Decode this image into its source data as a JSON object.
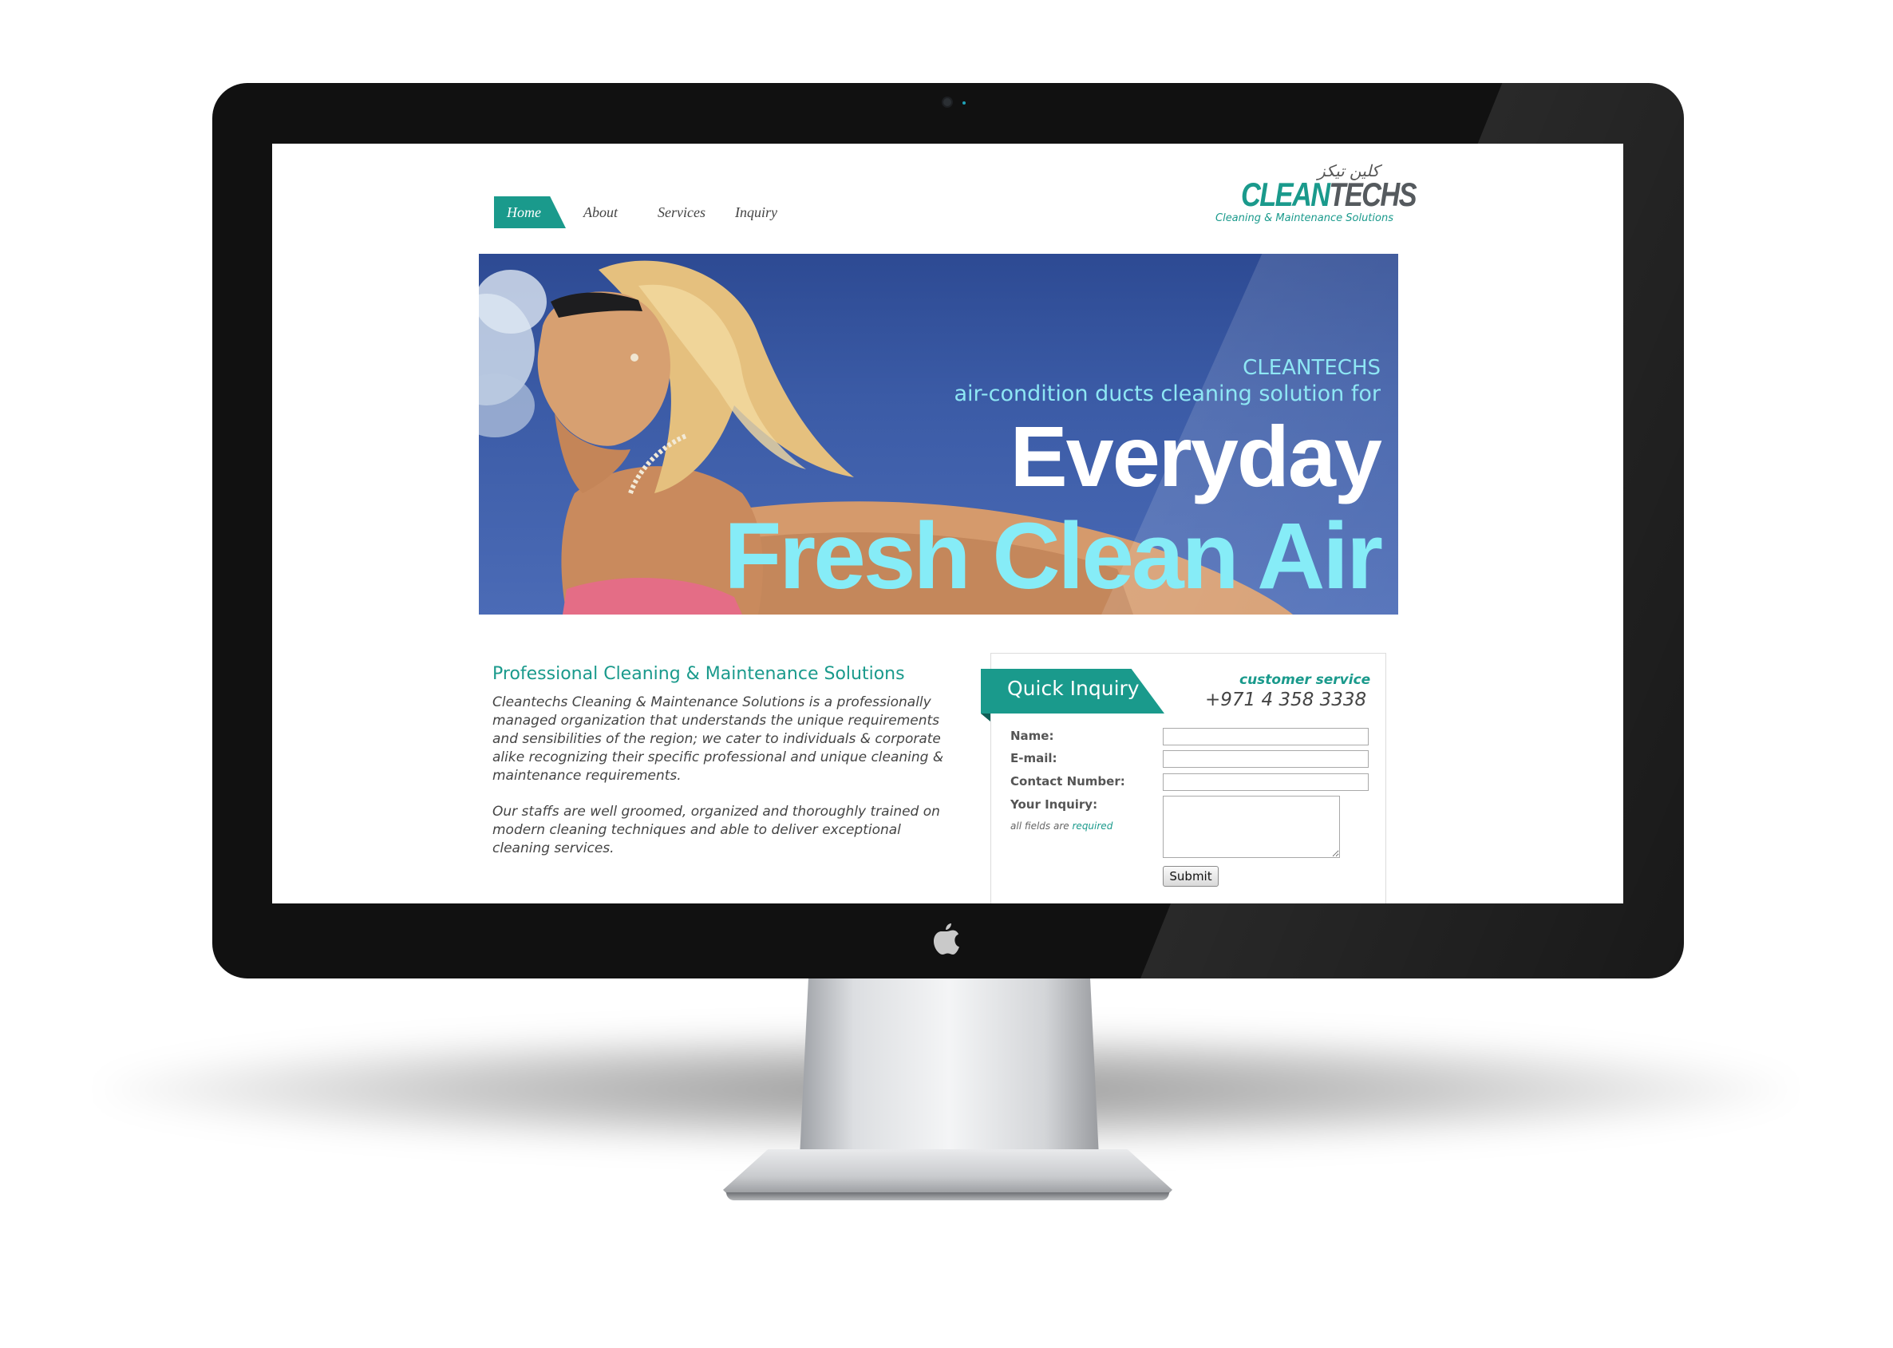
{
  "nav": {
    "items": [
      {
        "label": "Home",
        "active": true
      },
      {
        "label": "About",
        "active": false
      },
      {
        "label": "Services",
        "active": false
      },
      {
        "label": "Inquiry",
        "active": false
      }
    ]
  },
  "logo": {
    "arabic": "كلين تيكز",
    "word_part1": "CLEAN",
    "word_part2": "TECHS",
    "tagline": "Cleaning & Maintenance Solutions"
  },
  "hero": {
    "brand": "CLEANTECHS",
    "subtitle": "air-condition ducts cleaning solution for",
    "line1": "Everyday",
    "line2": "Fresh Clean Air"
  },
  "intro": {
    "heading": "Professional Cleaning & Maintenance Solutions",
    "paragraph1": "Cleantechs Cleaning & Maintenance Solutions is a professionally managed organization that understands the unique requirements and sensibilities of the region; we cater to individuals & corporate alike recognizing their specific professional and unique cleaning & maintenance requirements.",
    "paragraph2": "Our staffs are well groomed, organized and thoroughly trained on modern cleaning techniques and able to deliver exceptional cleaning services."
  },
  "inquiry": {
    "title": "Quick Inquiry",
    "customer_service_label": "customer service",
    "phone": "+971 4 358 3338",
    "fields": {
      "name_label": "Name:",
      "email_label": "E-mail:",
      "contact_label": "Contact Number:",
      "inquiry_label": "Your Inquiry:",
      "name_value": "",
      "email_value": "",
      "contact_value": "",
      "inquiry_value": ""
    },
    "note_prefix": "all fields are",
    "note_required": "required",
    "submit_label": "Submit"
  },
  "colors": {
    "brand_teal": "#1a9a8c",
    "hero_text_cyan": "#86ecf7",
    "hero_sky": "#3b5ba6",
    "bezel": "#111111"
  }
}
